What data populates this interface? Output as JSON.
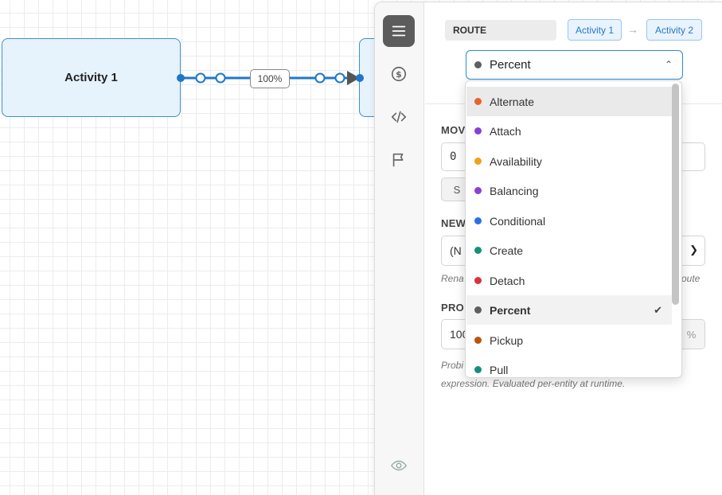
{
  "canvas": {
    "node1_label": "Activity 1",
    "edge_label": "100%"
  },
  "panel": {
    "route_badge": "ROUTE",
    "from_chip": "Activity 1",
    "to_chip": "Activity 2",
    "arrow": "→",
    "select": {
      "value": "Percent",
      "color": "#5f5f5f",
      "chevron": "⌃"
    },
    "fields": {
      "move_label": "MOV",
      "move_value": "0",
      "move_pill": "S",
      "new_label": "NEW",
      "new_value": "(N",
      "new_help_left": "Rena",
      "new_help_right": "route",
      "prob_label": "PROI",
      "prob_value": "100",
      "prob_unit": "%",
      "prob_help_1": "Probi",
      "prob_help_2": "expression. Evaluated per-entity at runtime."
    }
  },
  "dropdown": {
    "options": [
      {
        "label": "Alternate",
        "color": "#e8622a"
      },
      {
        "label": "Attach",
        "color": "#8a3fd8"
      },
      {
        "label": "Availability",
        "color": "#f0a020"
      },
      {
        "label": "Balancing",
        "color": "#8a3fd8"
      },
      {
        "label": "Conditional",
        "color": "#2d6fe0"
      },
      {
        "label": "Create",
        "color": "#14907a"
      },
      {
        "label": "Detach",
        "color": "#d8343a"
      },
      {
        "label": "Percent",
        "color": "#5f5f5f"
      },
      {
        "label": "Pickup",
        "color": "#b8560e"
      },
      {
        "label": "Pull",
        "color": "#14907a"
      }
    ],
    "hovered": "Alternate",
    "selected": "Percent",
    "check": "✔"
  },
  "rail": {
    "icons": [
      "menu-icon",
      "dollar-icon",
      "code-icon",
      "flag-icon",
      "eye-icon"
    ],
    "active": "menu-icon"
  }
}
